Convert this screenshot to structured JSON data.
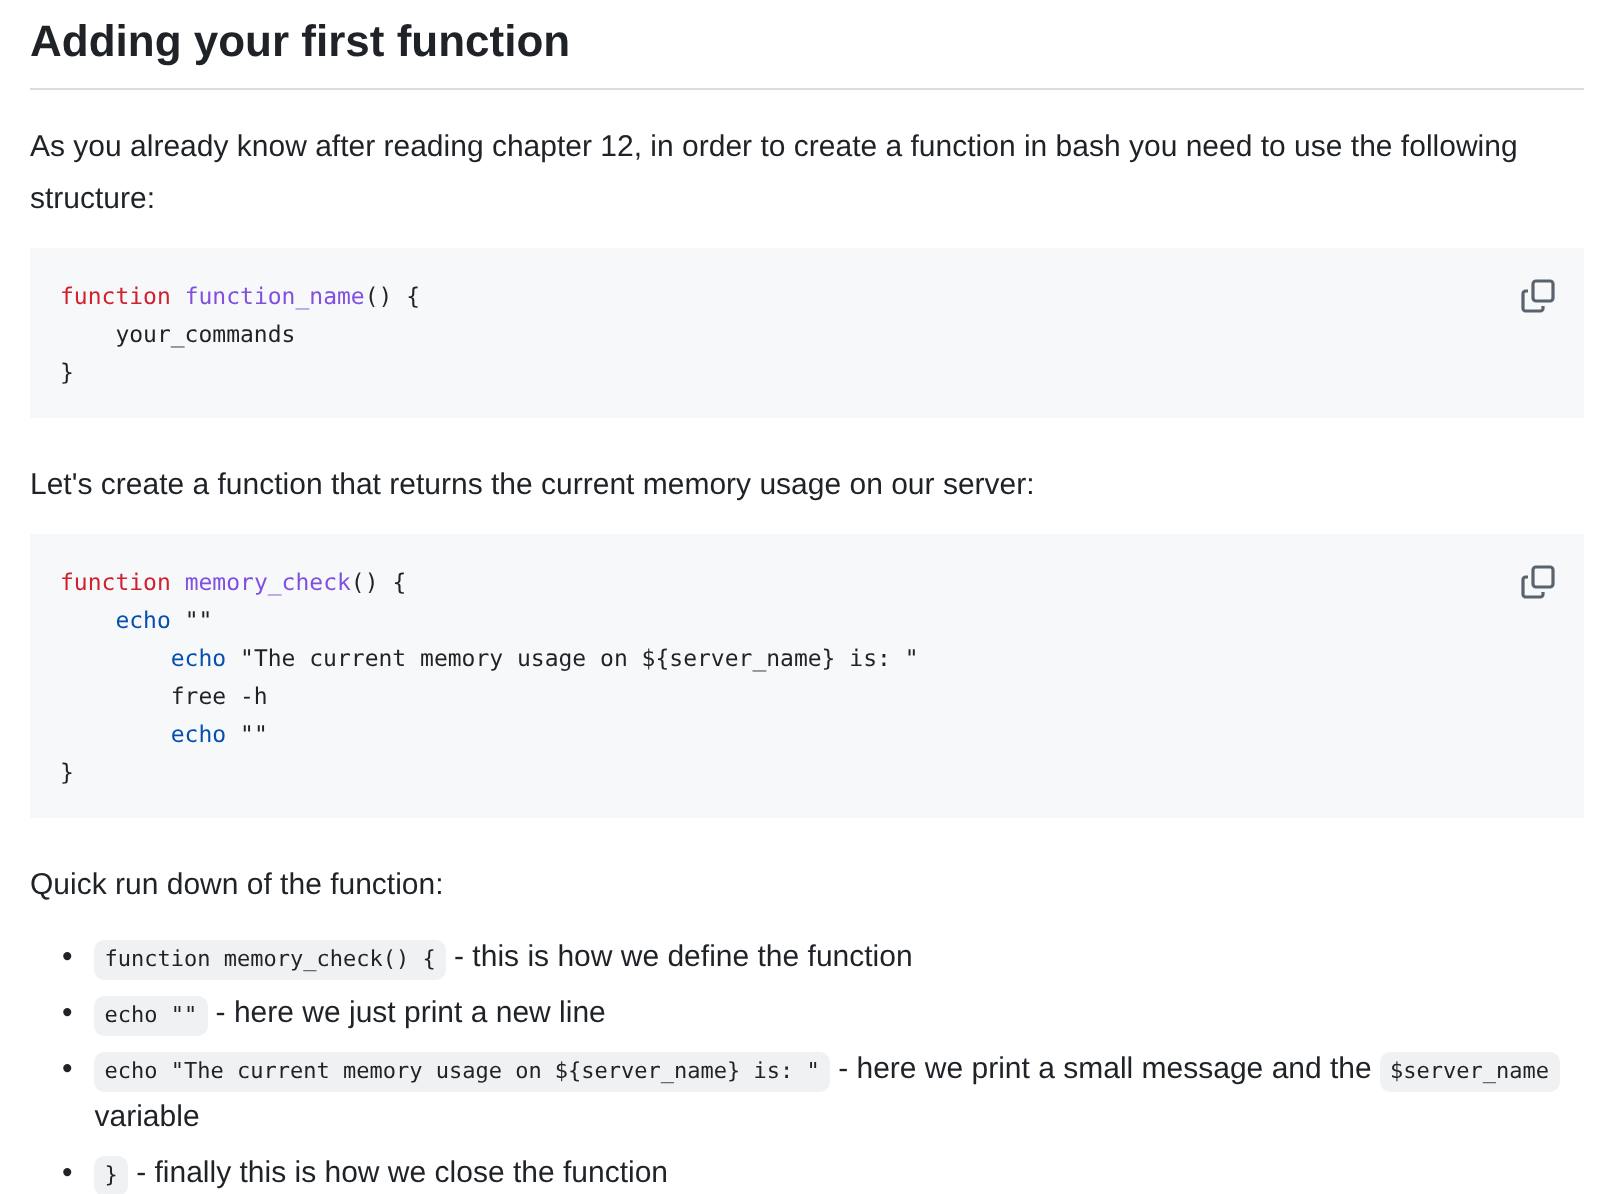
{
  "heading": "Adding your first function",
  "blocks": [
    {
      "kind": "paragraph",
      "text": "As you already know after reading chapter 12, in order to create a function in bash you need to use the following structure:"
    },
    {
      "kind": "code",
      "lines": [
        {
          "tokens": [
            {
              "kind": "keyword",
              "text": "function"
            },
            {
              "kind": "entity",
              "text": "function_name"
            },
            {
              "kind": "plain",
              "text": "() {",
              "attached": true
            }
          ],
          "children": [
            {
              "tokens": [
                {
                  "kind": "plain",
                  "text": "your_commands"
                }
              ]
            }
          ]
        },
        {
          "tokens": [
            {
              "kind": "plain",
              "text": "}"
            }
          ]
        }
      ]
    },
    {
      "kind": "paragraph",
      "text": "Let's create a function that returns the current memory usage on our server:"
    },
    {
      "kind": "code",
      "lines": [
        {
          "tokens": [
            {
              "kind": "keyword",
              "text": "function"
            },
            {
              "kind": "entity",
              "text": "memory_check"
            },
            {
              "kind": "plain",
              "text": "() {",
              "attached": true
            }
          ],
          "children": [
            {
              "tokens": [
                {
                  "kind": "builtin",
                  "text": "echo"
                },
                {
                  "kind": "plain",
                  "text": "\"\""
                }
              ],
              "children": [
                {
                  "tokens": [
                    {
                      "kind": "builtin",
                      "text": "echo"
                    },
                    {
                      "kind": "plain",
                      "text": "\"The current memory usage on ${server_name} is: \""
                    }
                  ]
                },
                {
                  "tokens": [
                    {
                      "kind": "plain",
                      "text": "free -h"
                    }
                  ]
                },
                {
                  "tokens": [
                    {
                      "kind": "builtin",
                      "text": "echo"
                    },
                    {
                      "kind": "plain",
                      "text": "\"\""
                    }
                  ]
                }
              ]
            }
          ]
        },
        {
          "tokens": [
            {
              "kind": "plain",
              "text": "}"
            }
          ]
        }
      ]
    },
    {
      "kind": "paragraph",
      "text": "Quick run down of the function:"
    },
    {
      "kind": "list",
      "items": [
        {
          "marker": "•",
          "parts": [
            {
              "kind": "code",
              "text": "function memory_check() {"
            },
            {
              "kind": "text",
              "text": "- this is how we define the function"
            }
          ]
        },
        {
          "marker": "•",
          "parts": [
            {
              "kind": "code",
              "text": "echo \"\""
            },
            {
              "kind": "text",
              "text": "- here we just print a new line"
            }
          ]
        },
        {
          "marker": "•",
          "parts": [
            {
              "kind": "code",
              "text": "echo \"The current memory usage on ${server_name} is: \""
            },
            {
              "kind": "text",
              "text": "- here we print a small message and the"
            },
            {
              "kind": "code",
              "text": "$server_name"
            },
            {
              "kind": "text",
              "text": "variable"
            }
          ]
        },
        {
          "marker": "•",
          "parts": [
            {
              "kind": "code",
              "text": "}"
            },
            {
              "kind": "text",
              "text": "- finally this is how we close the function"
            }
          ]
        }
      ]
    }
  ]
}
